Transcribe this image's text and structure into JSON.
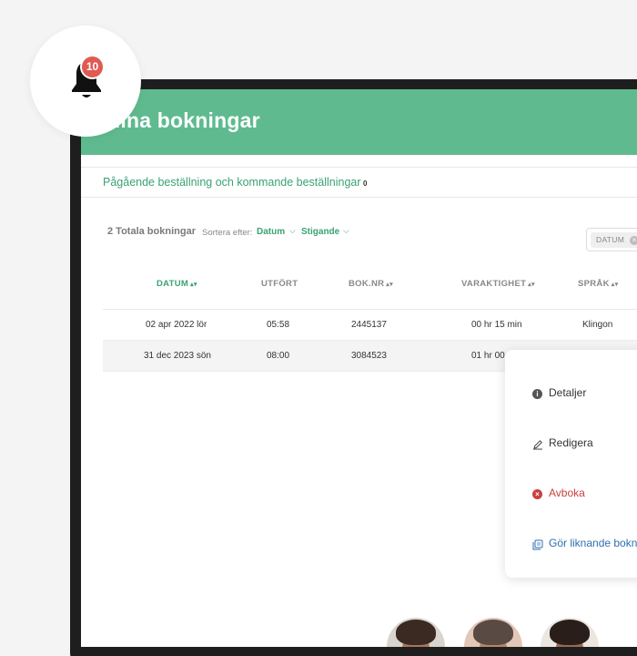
{
  "notifications": {
    "count": "10"
  },
  "header": {
    "title": "Mina bokningar"
  },
  "tabs": {
    "active_label": "Pågående beställning och kommande beställningar",
    "count": "0"
  },
  "summary": {
    "total": "2 Totala bokningar"
  },
  "sort": {
    "label": "Sortera efter:",
    "field": "Datum",
    "order": "Stigande"
  },
  "filter": {
    "chip_label": "DATUM"
  },
  "table": {
    "columns": [
      "DATUM",
      "UTFÖRT",
      "BOK.NR",
      "VARAKTIGHET",
      "SPRÅK"
    ],
    "rows": [
      {
        "date": "02 apr 2022 lör",
        "time": "05:58",
        "number": "2445137",
        "duration": "00 hr 15 min",
        "language": "Klingon"
      },
      {
        "date": "31 dec 2023 sön",
        "time": "08:00",
        "number": "3084523",
        "duration": "01 hr 00",
        "language": ""
      }
    ]
  },
  "context_menu": {
    "items": [
      {
        "label": "Detaljer",
        "icon": "info-icon"
      },
      {
        "label": "Redigera",
        "icon": "pencil-icon"
      },
      {
        "label": "Avboka",
        "icon": "cancel-icon"
      },
      {
        "label": "Gör liknande bokn",
        "icon": "copy-icon"
      }
    ]
  },
  "colors": {
    "accent": "#5fbb8f",
    "accent_text": "#3aa274",
    "danger": "#c94040",
    "link": "#2f6fb0",
    "badge": "#e05a52"
  }
}
